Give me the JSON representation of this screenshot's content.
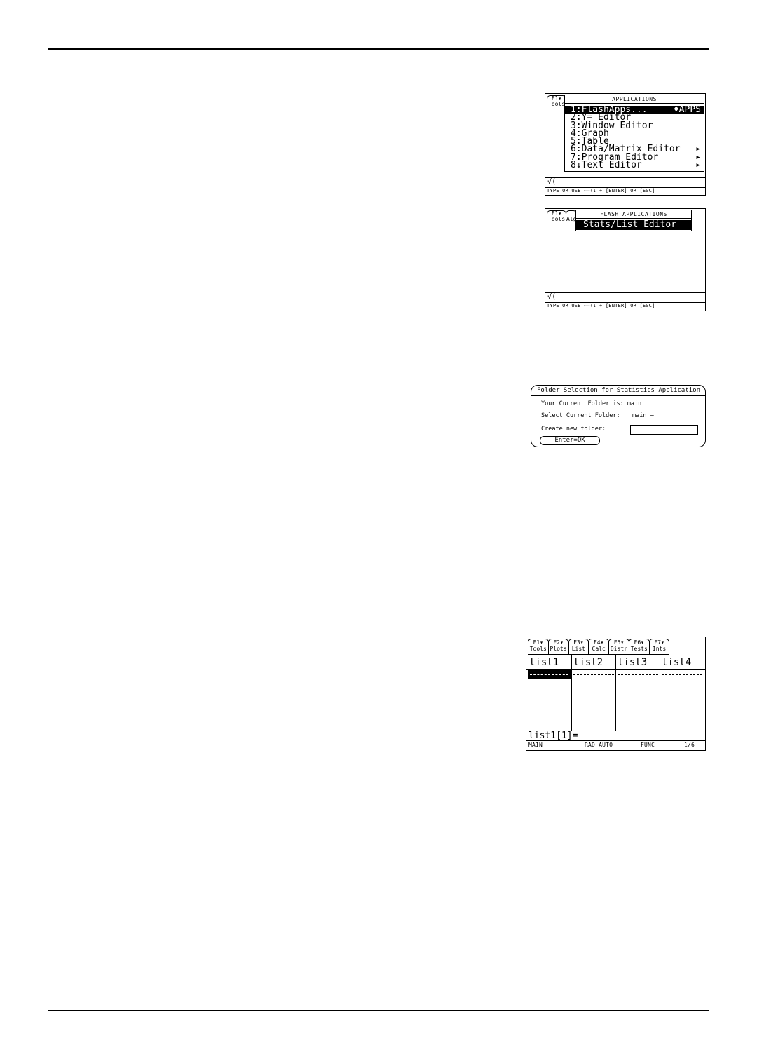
{
  "screen_apps": {
    "tab_f1": "F1▾",
    "tab_tools": "Tools",
    "menu_title": "APPLICATIONS",
    "items": [
      {
        "label": "1:FlashApps...",
        "right": "♦APPS",
        "selected": true
      },
      {
        "label": "2:Y= Editor",
        "right": "",
        "selected": false
      },
      {
        "label": "3:Window Editor",
        "right": "",
        "selected": false
      },
      {
        "label": "4:Graph",
        "right": "",
        "selected": false
      },
      {
        "label": "5:Table",
        "right": "",
        "selected": false
      },
      {
        "label": "6:Data/Matrix Editor",
        "right": "▸",
        "selected": false
      },
      {
        "label": "7:Program Editor",
        "right": "▸",
        "selected": false
      },
      {
        "label": "8↓Text Editor",
        "right": "▸",
        "selected": false
      }
    ],
    "entry": "√(",
    "status": "TYPE OR USE ←→↑↓ + [ENTER] OR [ESC]"
  },
  "screen_flash": {
    "tab_f1": "F1▾",
    "tab_tools": "Tools",
    "tab_partial": "Alg",
    "menu_title": "FLASH APPLICATIONS",
    "item": "Stats/List Editor",
    "entry": "√(",
    "status": "TYPE OR USE ←→↑↓ + [ENTER] OR [ESC]"
  },
  "screen_folder": {
    "title": "Folder Selection for Statistics Application",
    "current_label": "Your Current Folder is: main",
    "select_label": "Select Current Folder:",
    "select_value": "main →",
    "create_label": "Create new folder:",
    "create_value": "",
    "enter_button": "Enter=OK"
  },
  "screen_stats": {
    "tabs": [
      {
        "top": "F1▾",
        "bottom": "Tools"
      },
      {
        "top": "F2▾",
        "bottom": "Plots"
      },
      {
        "top": "F3▾",
        "bottom": "List"
      },
      {
        "top": "F4▾",
        "bottom": "Calc"
      },
      {
        "top": "F5▾",
        "bottom": "Distr"
      },
      {
        "top": "F6▾",
        "bottom": "Tests"
      },
      {
        "top": "F7▾",
        "bottom": "Ints"
      }
    ],
    "columns": [
      "list1",
      "list2",
      "list3",
      "list4"
    ],
    "entry": "list1[1]=",
    "status_folder": "MAIN",
    "status_mode": "RAD AUTO",
    "status_graph": "FUNC",
    "status_page": "1/6"
  }
}
